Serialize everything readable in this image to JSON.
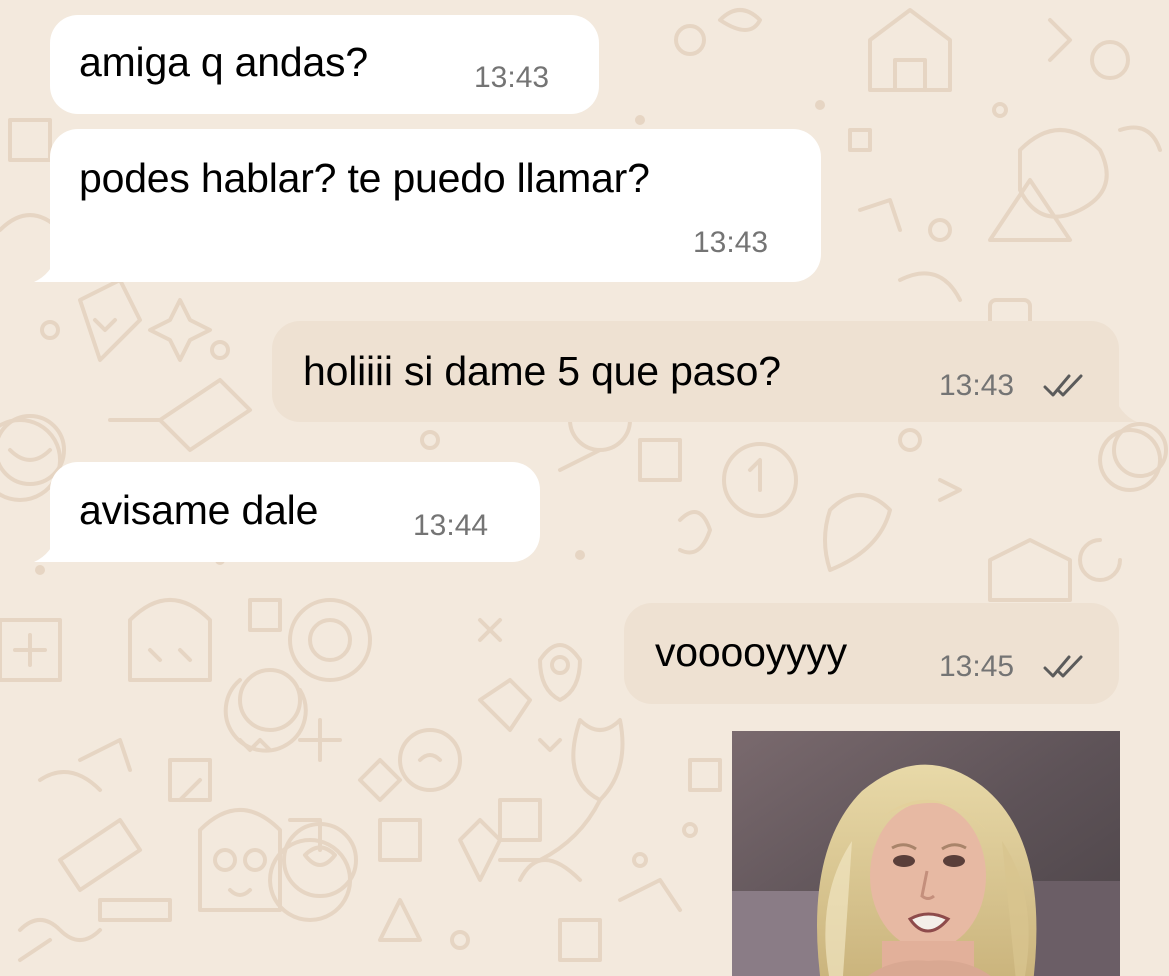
{
  "colors": {
    "wallpaper": "#f3e9dd",
    "incoming_bubble": "#ffffff",
    "outgoing_bubble": "#eee1d2",
    "timestamp": "#747474",
    "read_ticks": "#5b5b5b"
  },
  "messages": [
    {
      "direction": "incoming",
      "text": "amiga q andas?",
      "time": "13:43"
    },
    {
      "direction": "incoming",
      "text": "podes hablar? te puedo llamar?",
      "time": "13:43"
    },
    {
      "direction": "outgoing",
      "text": "holiiii si dame 5 que paso?",
      "time": "13:43",
      "status_icon": "double-check-icon"
    },
    {
      "direction": "incoming",
      "text": "avisame dale",
      "time": "13:44"
    },
    {
      "direction": "outgoing",
      "text": "vooooyyyy",
      "time": "13:45",
      "status_icon": "double-check-icon"
    },
    {
      "direction": "outgoing",
      "type": "image",
      "description_icon": "photo-message"
    }
  ]
}
